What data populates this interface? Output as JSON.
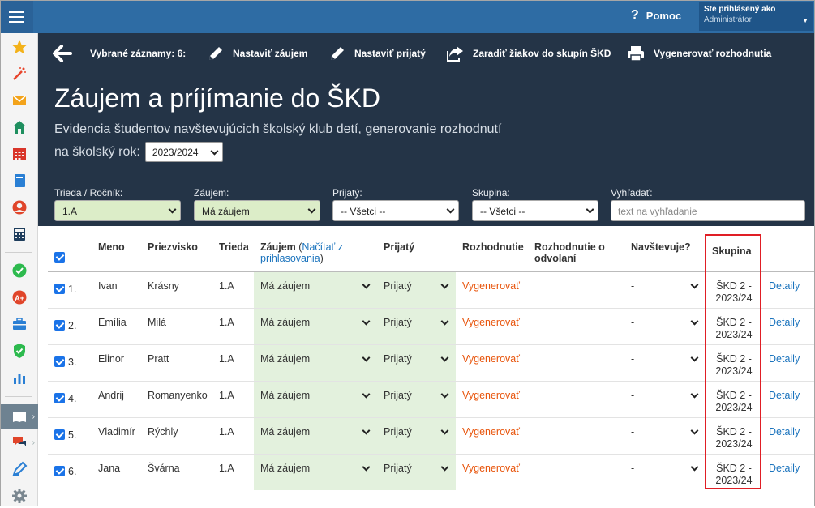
{
  "topbar": {
    "help_label": "Pomoc",
    "user_line1": "Ste prihlásený ako",
    "user_line2": "Administrátor"
  },
  "toolbar": {
    "selected": "Vybrané záznamy: 6:",
    "set_interest": "Nastaviť záujem",
    "set_accepted": "Nastaviť prijatý",
    "assign_groups": "Zaradiť žiakov do skupín ŠKD",
    "generate": "Vygenerovať rozhodnutia"
  },
  "page": {
    "title": "Záujem a príjímanie do ŠKD",
    "subtitle": "Evidencia študentov navštevujúcich školský klub detí, generovanie rozhodnutí",
    "year_label": "na školský rok:",
    "year_value": "2023/2024"
  },
  "filters": {
    "class_label": "Trieda / Ročník:",
    "class_value": "1.A",
    "interest_label": "Záujem:",
    "interest_value": "Má záujem",
    "accepted_label": "Prijatý:",
    "accepted_value": "-- Všetci --",
    "group_label": "Skupina:",
    "group_value": "-- Všetci --",
    "search_label": "Vyhľadať:",
    "search_placeholder": "text na vyhľadanie"
  },
  "table": {
    "headers": {
      "name": "Meno",
      "surname": "Priezvisko",
      "class": "Trieda",
      "interest": "Záujem",
      "interest_link": "Načítať z prihlasovania",
      "accepted": "Prijatý",
      "decision": "Rozhodnutie",
      "appeal": "Rozhodnutie o odvolaní",
      "attends": "Navštevuje?",
      "group": "Skupina"
    },
    "rows": [
      {
        "num": "1.",
        "name": "Ivan",
        "surname": "Krásny",
        "class": "1.A",
        "interest": "Má záujem",
        "accepted": "Prijatý",
        "decision": "Vygenerovať",
        "attends": "-",
        "group_line1": "ŠKD 2 -",
        "group_line2": "2023/24",
        "detail": "Detaily"
      },
      {
        "num": "2.",
        "name": "Emília",
        "surname": "Milá",
        "class": "1.A",
        "interest": "Má záujem",
        "accepted": "Prijatý",
        "decision": "Vygenerovať",
        "attends": "-",
        "group_line1": "ŠKD 2 -",
        "group_line2": "2023/24",
        "detail": "Detaily"
      },
      {
        "num": "3.",
        "name": "Elinor",
        "surname": "Pratt",
        "class": "1.A",
        "interest": "Má záujem",
        "accepted": "Prijatý",
        "decision": "Vygenerovať",
        "attends": "-",
        "group_line1": "ŠKD 2 -",
        "group_line2": "2023/24",
        "detail": "Detaily"
      },
      {
        "num": "4.",
        "name": "Andrij",
        "surname": "Romanyenko",
        "class": "1.A",
        "interest": "Má záujem",
        "accepted": "Prijatý",
        "decision": "Vygenerovať",
        "attends": "-",
        "group_line1": "ŠKD 2 -",
        "group_line2": "2023/24",
        "detail": "Detaily"
      },
      {
        "num": "5.",
        "name": "Vladimír",
        "surname": "Rýchly",
        "class": "1.A",
        "interest": "Má záujem",
        "accepted": "Prijatý",
        "decision": "Vygenerovať",
        "attends": "-",
        "group_line1": "ŠKD 2 -",
        "group_line2": "2023/24",
        "detail": "Detaily"
      },
      {
        "num": "6.",
        "name": "Jana",
        "surname": "Švárna",
        "class": "1.A",
        "interest": "Má záujem",
        "accepted": "Prijatý",
        "decision": "Vygenerovať",
        "attends": "-",
        "group_line1": "ŠKD 2 -",
        "group_line2": "2023/24",
        "detail": "Detaily"
      }
    ]
  },
  "colors": {
    "topbar": "#2e6ca4",
    "header_bg": "#243447",
    "green_filter": "#dcedc8",
    "link": "#1a73bd",
    "orange": "#e8540b",
    "highlight": "#e01e25"
  },
  "icons": {
    "sidebar": [
      "star-icon",
      "magic-wand-icon",
      "envelope-icon",
      "home-icon",
      "calendar-icon",
      "notebook-icon",
      "user-icon",
      "calculator-icon",
      "check-circle-icon",
      "grade-icon",
      "briefcase-icon",
      "shield-check-icon",
      "bar-chart-icon",
      "book-open-icon",
      "chat-icon",
      "pen-icon",
      "gear-icon"
    ]
  }
}
